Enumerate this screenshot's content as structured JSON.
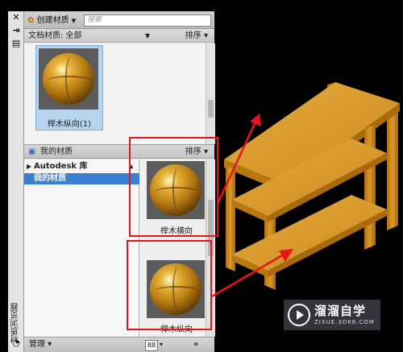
{
  "palette": {
    "vertical_title": "材质浏览器",
    "icons": [
      "close-icon",
      "auto-hide-icon",
      "properties-icon"
    ]
  },
  "toolbar": {
    "create_material_label": "创建材质",
    "search_placeholder": "搜索"
  },
  "document_materials": {
    "filter_label": "文档材质: 全部",
    "sort_label": "排序",
    "items": [
      {
        "name": "榉木纵向(1)",
        "selected": true
      }
    ]
  },
  "my_materials": {
    "header_label": "我的材质",
    "sort_label": "排序",
    "tree": [
      {
        "label": "Autodesk 库",
        "expandable": true,
        "selected": false
      },
      {
        "label": "我的材质",
        "expandable": false,
        "selected": true
      }
    ],
    "items": [
      {
        "name": "榉木横向"
      },
      {
        "name": "榉木纵向"
      }
    ]
  },
  "bottom_bar": {
    "manage_label": "管理",
    "view_label": "88",
    "expand_label": "»"
  },
  "watermark": {
    "title": "溜溜自学",
    "url": "ZIXUE.3D66.COM"
  },
  "colors": {
    "highlight_red": "#e8141c",
    "selection_blue": "#3a7fd0",
    "wood": "#c8891c"
  }
}
